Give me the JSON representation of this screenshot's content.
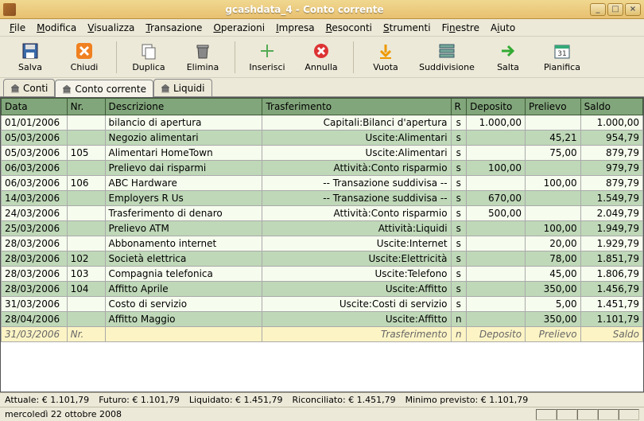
{
  "window": {
    "title": "gcashdata_4 - Conto corrente",
    "min": "_",
    "max": "□",
    "close": "×"
  },
  "menu": {
    "file": "File",
    "modifica": "Modifica",
    "visualizza": "Visualizza",
    "transazione": "Transazione",
    "operazioni": "Operazioni",
    "impresa": "Impresa",
    "resoconti": "Resoconti",
    "strumenti": "Strumenti",
    "finestre": "Finestre",
    "aiuto": "Aiuto"
  },
  "toolbar": {
    "salva": "Salva",
    "chiudi": "Chiudi",
    "duplica": "Duplica",
    "elimina": "Elimina",
    "inserisci": "Inserisci",
    "annulla": "Annulla",
    "vuota": "Vuota",
    "suddivisione": "Suddivisione",
    "salta": "Salta",
    "pianifica": "Pianifica"
  },
  "tabs": {
    "t1": "Conti",
    "t2": "Conto corrente",
    "t3": "Liquidi"
  },
  "headers": {
    "data": "Data",
    "nr": "Nr.",
    "desc": "Descrizione",
    "trans": "Trasferimento",
    "r": "R",
    "dep": "Deposito",
    "pre": "Prelievo",
    "sal": "Saldo"
  },
  "rows": [
    {
      "data": "01/01/2006",
      "nr": "",
      "desc": "bilancio di apertura",
      "trans": "Capitali:Bilanci d'apertura",
      "r": "s",
      "dep": "1.000,00",
      "pre": "",
      "sal": "1.000,00"
    },
    {
      "data": "05/03/2006",
      "nr": "",
      "desc": "Negozio alimentari",
      "trans": "Uscite:Alimentari",
      "r": "s",
      "dep": "",
      "pre": "45,21",
      "sal": "954,79"
    },
    {
      "data": "05/03/2006",
      "nr": "105",
      "desc": "Alimentari HomeTown",
      "trans": "Uscite:Alimentari",
      "r": "s",
      "dep": "",
      "pre": "75,00",
      "sal": "879,79"
    },
    {
      "data": "06/03/2006",
      "nr": "",
      "desc": "Prelievo dai risparmi",
      "trans": "Attività:Conto risparmio",
      "r": "s",
      "dep": "100,00",
      "pre": "",
      "sal": "979,79"
    },
    {
      "data": "06/03/2006",
      "nr": "106",
      "desc": "ABC Hardware",
      "trans": "-- Transazione suddivisa --",
      "r": "s",
      "dep": "",
      "pre": "100,00",
      "sal": "879,79"
    },
    {
      "data": "14/03/2006",
      "nr": "",
      "desc": "Employers R Us",
      "trans": "-- Transazione suddivisa --",
      "r": "s",
      "dep": "670,00",
      "pre": "",
      "sal": "1.549,79"
    },
    {
      "data": "24/03/2006",
      "nr": "",
      "desc": "Trasferimento di denaro",
      "trans": "Attività:Conto risparmio",
      "r": "s",
      "dep": "500,00",
      "pre": "",
      "sal": "2.049,79"
    },
    {
      "data": "25/03/2006",
      "nr": "",
      "desc": "Prelievo ATM",
      "trans": "Attività:Liquidi",
      "r": "s",
      "dep": "",
      "pre": "100,00",
      "sal": "1.949,79"
    },
    {
      "data": "28/03/2006",
      "nr": "",
      "desc": "Abbonamento internet",
      "trans": "Uscite:Internet",
      "r": "s",
      "dep": "",
      "pre": "20,00",
      "sal": "1.929,79"
    },
    {
      "data": "28/03/2006",
      "nr": "102",
      "desc": "Società elettrica",
      "trans": "Uscite:Elettricità",
      "r": "s",
      "dep": "",
      "pre": "78,00",
      "sal": "1.851,79"
    },
    {
      "data": "28/03/2006",
      "nr": "103",
      "desc": "Compagnia telefonica",
      "trans": "Uscite:Telefono",
      "r": "s",
      "dep": "",
      "pre": "45,00",
      "sal": "1.806,79"
    },
    {
      "data": "28/03/2006",
      "nr": "104",
      "desc": "Affitto Aprile",
      "trans": "Uscite:Affitto",
      "r": "s",
      "dep": "",
      "pre": "350,00",
      "sal": "1.456,79"
    },
    {
      "data": "31/03/2006",
      "nr": "",
      "desc": "Costo di servizio",
      "trans": "Uscite:Costi di servizio",
      "r": "s",
      "dep": "",
      "pre": "5,00",
      "sal": "1.451,79"
    },
    {
      "data": "28/04/2006",
      "nr": "",
      "desc": "Affitto Maggio",
      "trans": "Uscite:Affitto",
      "r": "n",
      "dep": "",
      "pre": "350,00",
      "sal": "1.101,79"
    }
  ],
  "blankrow": {
    "data": "31/03/2006",
    "nr": "Nr.",
    "desc": "",
    "trans": "Trasferimento",
    "r": "n",
    "dep": "Deposito",
    "pre": "Prelievo",
    "sal": "Saldo"
  },
  "summary": {
    "attuale_l": "Attuale:",
    "attuale_v": "€ 1.101,79",
    "futuro_l": "Futuro:",
    "futuro_v": "€ 1.101,79",
    "liquidato_l": "Liquidato:",
    "liquidato_v": "€ 1.451,79",
    "riconciliato_l": "Riconciliato:",
    "riconciliato_v": "€ 1.451,79",
    "minimo_l": "Minimo previsto:",
    "minimo_v": "€ 1.101,79"
  },
  "datebar": "mercoledì 22 ottobre 2008"
}
